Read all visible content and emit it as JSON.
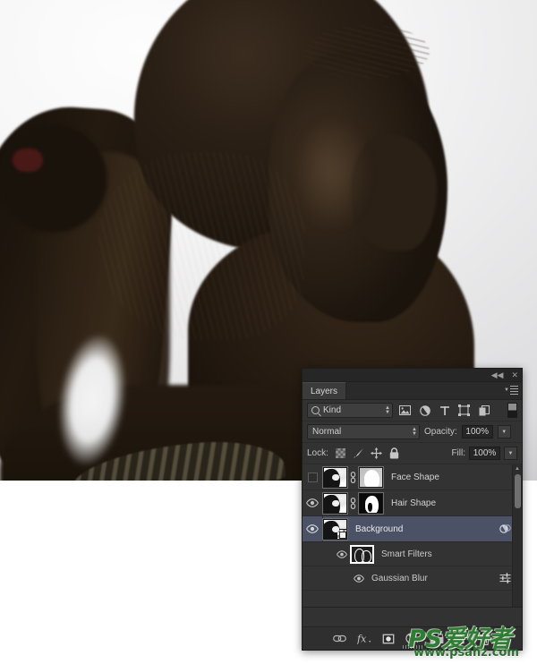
{
  "photo": {
    "subject": "silhouetted profile portrait of a woman facing right",
    "background_color": "#f4f4f5",
    "silhouette_color": "#241a12",
    "hairband_color": "#4d1a18"
  },
  "panel": {
    "topbar": {
      "collapse_icon": "collapse-double-arrow-icon",
      "collapse_glyph": "◀◀",
      "close_icon": "close-icon",
      "close_glyph": "✕"
    },
    "tabs": [
      {
        "label": "Layers",
        "active": true
      }
    ],
    "menu_icon": "panel-menu-icon",
    "filter_row": {
      "search_icon": "search-icon",
      "kind_label": "Kind",
      "icons": [
        "filter-pixel-layers-icon",
        "filter-adjustment-layers-icon",
        "filter-type-layers-icon",
        "filter-shape-layers-icon",
        "filter-smart-object-icon"
      ],
      "toggle_icon": "filter-enable-toggle"
    },
    "blend_row": {
      "blend_mode": "Normal",
      "opacity_label": "Opacity:",
      "opacity_value": "100%"
    },
    "lock_row": {
      "lock_label": "Lock:",
      "lock_icons": [
        "lock-transparent-pixels-icon",
        "lock-image-pixels-icon",
        "lock-position-icon",
        "lock-all-icon"
      ],
      "fill_label": "Fill:",
      "fill_value": "100%"
    },
    "layers": [
      {
        "name": "Face Shape",
        "visible": false,
        "visibility_icon": "eye-off-checkbox",
        "thumbnail": "layer-thumbnail",
        "link_icon": "link-mask-icon",
        "mask": "white-layer-mask",
        "selected": false
      },
      {
        "name": "Hair Shape",
        "visible": true,
        "visibility_icon": "eye-icon",
        "thumbnail": "layer-thumbnail",
        "link_icon": "link-mask-icon",
        "mask": "black-layer-mask",
        "selected": false
      },
      {
        "name": "Background",
        "visible": true,
        "visibility_icon": "eye-icon",
        "thumbnail": "smart-object-thumbnail",
        "badge": "smart-filters-badge-icon",
        "selected": true
      }
    ],
    "smart_filters": {
      "group_label": "Smart Filters",
      "group_visible": true,
      "group_thumbnail": "smart-filter-mask-thumbnail",
      "items": [
        {
          "name": "Gaussian Blur",
          "visible": true,
          "settings_icon": "filter-settings-sliders-icon"
        }
      ]
    },
    "scrollbar": {
      "up_arrow_icon": "scroll-up-arrow-icon"
    },
    "bottom_toolbar": [
      "link-layers-icon",
      "add-layer-style-fx-icon",
      "add-layer-mask-icon",
      "new-adjustment-layer-icon",
      "new-group-icon",
      "new-layer-icon",
      "delete-layer-icon"
    ],
    "resize_handle_icon": "panel-resize-grip"
  },
  "watermark": {
    "main_text": "PS爱好者",
    "url_text": "www.psahz.com",
    "color": "#2f7d32"
  }
}
